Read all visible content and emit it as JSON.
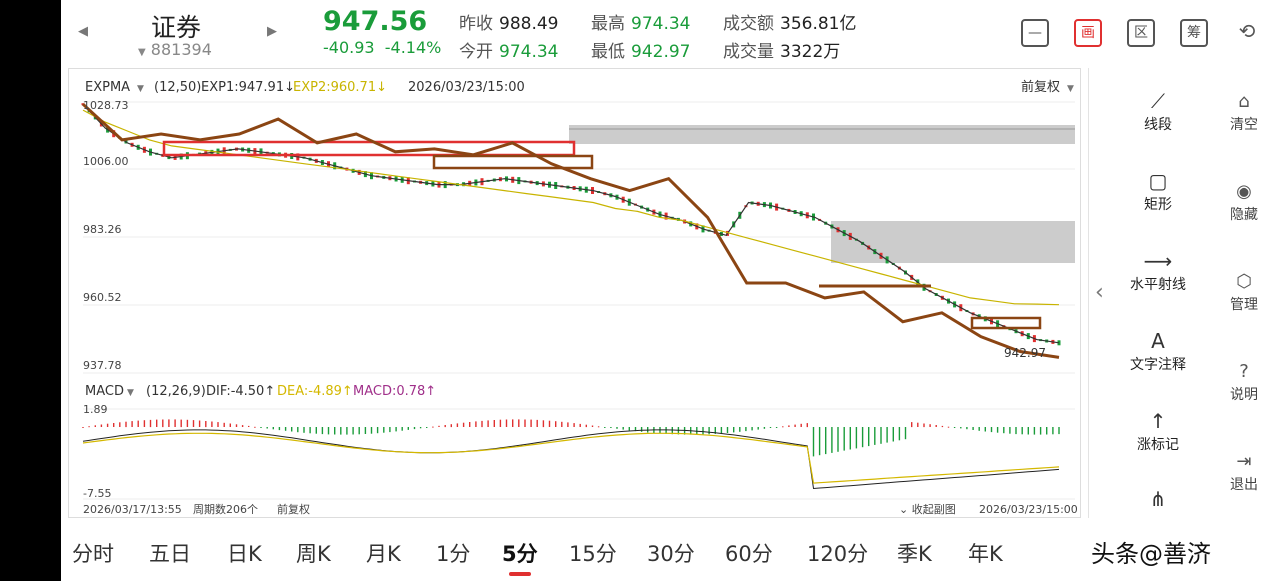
{
  "header": {
    "name": "证券",
    "code": "881394",
    "price": "947.56",
    "change": "-40.93",
    "change_pct": "-4.14%",
    "prev_close_label": "昨收",
    "prev_close": "988.49",
    "open_label": "今开",
    "open": "974.34",
    "high_label": "最高",
    "high": "974.34",
    "low_label": "最低",
    "low": "942.97",
    "amount_label": "成交额",
    "amount": "356.81亿",
    "volume_label": "成交量",
    "volume": "3322万",
    "icons": [
      "minus-box-icon",
      "draw-icon",
      "zone-icon",
      "chip-icon",
      "rotate-screen-icon"
    ],
    "icon_glyphs": [
      "—",
      "画",
      "区",
      "筹",
      "⟲"
    ]
  },
  "chart": {
    "indicator": "EXPMA",
    "params": "(12,50)",
    "exp1": "EXP1:947.91↓",
    "exp2": "EXP2:960.71↓",
    "datetime": "2026/03/23/15:00",
    "adjust": "前复权",
    "y_labels": [
      "1028.73",
      "1006.00",
      "983.26",
      "960.52",
      "937.78"
    ],
    "last_label": "942.97",
    "macd_name": "MACD",
    "macd_params": "(12,26,9)",
    "dif": "DIF:-4.50↑",
    "dea": "DEA:-4.89↑",
    "macd": "MACD:0.78↑",
    "macd_y": [
      "1.89",
      "-7.55"
    ],
    "start_time": "2026/03/17/13:55",
    "period_count": "周期数206个",
    "adjust_bottom": "前复权",
    "collapse": "收起副图",
    "end_time": "2026/03/23/15:00",
    "colors": {
      "up": "#e03030",
      "down": "#1a9c3a",
      "exp1": "#333333",
      "exp2": "#c8b400",
      "trend": "#8b4513",
      "dif": "#222222",
      "dea": "#d4b800"
    }
  },
  "chart_data": {
    "type": "line",
    "y_range": [
      937.78,
      1028.73
    ],
    "series_exp1": [
      1028,
      1020,
      1015,
      1012,
      1010,
      1011,
      1012,
      1013,
      1012,
      1011,
      1010,
      1008,
      1006,
      1004,
      1003,
      1002,
      1001,
      1001,
      1002,
      1003,
      1002,
      1001,
      1000,
      999,
      997,
      994,
      991,
      989,
      986,
      984,
      995,
      994,
      992,
      990,
      986,
      982,
      977,
      972,
      966,
      962,
      958,
      955,
      952,
      949,
      947.91
    ],
    "series_exp2": [
      1026,
      1022,
      1019,
      1016,
      1014,
      1013,
      1012,
      1011,
      1010,
      1009,
      1008,
      1007,
      1006,
      1005,
      1004,
      1003,
      1002,
      1001,
      1000,
      999,
      998,
      997,
      996,
      995,
      993,
      992,
      990,
      989,
      987,
      985,
      983,
      981,
      979,
      977,
      975,
      973,
      971,
      969,
      967,
      965,
      963,
      962,
      961,
      960.9,
      960.71
    ],
    "trend_points": [
      1028,
      1016,
      1018,
      1016,
      1018,
      1023,
      1015,
      1018,
      1012,
      1013,
      1011,
      1015,
      1008,
      1003,
      999,
      1003,
      990,
      968,
      968,
      963,
      965,
      955,
      958,
      950,
      945,
      943
    ],
    "macd_range": [
      -7.55,
      1.89
    ]
  },
  "sidebar": {
    "tools": [
      {
        "icon": "line-segment-icon",
        "glyph": "⟋",
        "label": "线段"
      },
      {
        "icon": "rectangle-icon",
        "glyph": "▢",
        "label": "矩形"
      },
      {
        "icon": "horizontal-ray-icon",
        "glyph": "⟶",
        "label": "水平射线"
      },
      {
        "icon": "text-icon",
        "glyph": "A",
        "label": "文字注释"
      },
      {
        "icon": "up-arrow-icon",
        "glyph": "↑",
        "label": "涨标记"
      },
      {
        "icon": "more-icon",
        "glyph": "⋔",
        "label": ""
      }
    ],
    "actions": [
      {
        "icon": "clear-icon",
        "glyph": "⌂",
        "label": "清空"
      },
      {
        "icon": "eye-icon",
        "glyph": "◉",
        "label": "隐藏"
      },
      {
        "icon": "manage-icon",
        "glyph": "⬡",
        "label": "管理"
      },
      {
        "icon": "help-icon",
        "glyph": "?",
        "label": "说明"
      },
      {
        "icon": "exit-icon",
        "glyph": "⇥",
        "label": "退出"
      }
    ],
    "collapse_glyph": "‹"
  },
  "tabs": [
    "分时",
    "五日",
    "日K",
    "周K",
    "月K",
    "1分",
    "5分",
    "15分",
    "30分",
    "60分",
    "120分",
    "季K",
    "年K"
  ],
  "active_tab": "5分",
  "watermark": "头条@善济"
}
